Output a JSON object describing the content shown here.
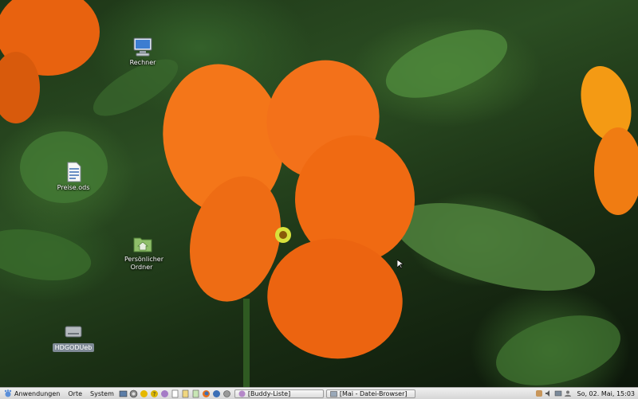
{
  "desktop": {
    "icons": [
      {
        "label": "Rechner",
        "icon": "computer-icon"
      },
      {
        "label": "Preise.ods",
        "icon": "spreadsheet-file-icon"
      },
      {
        "label": "Persönlicher Ordner",
        "icon": "home-folder-icon"
      },
      {
        "label": "HDGODUeb",
        "icon": "drive-icon"
      }
    ]
  },
  "panel": {
    "menus": {
      "applications": "Anwendungen",
      "places": "Orte",
      "system": "System"
    },
    "tasks": [
      {
        "label": "[Buddy-Liste]",
        "icon": "pidgin-icon"
      },
      {
        "label": "[Mai - Datei-Browser]",
        "icon": "folder-window-icon"
      }
    ],
    "clock": "So, 02. Mai, 15:03"
  },
  "colors": {
    "panel_bg": "#e3e3e3",
    "flower": "#f26a10",
    "leaf": "#3f6d2d"
  }
}
